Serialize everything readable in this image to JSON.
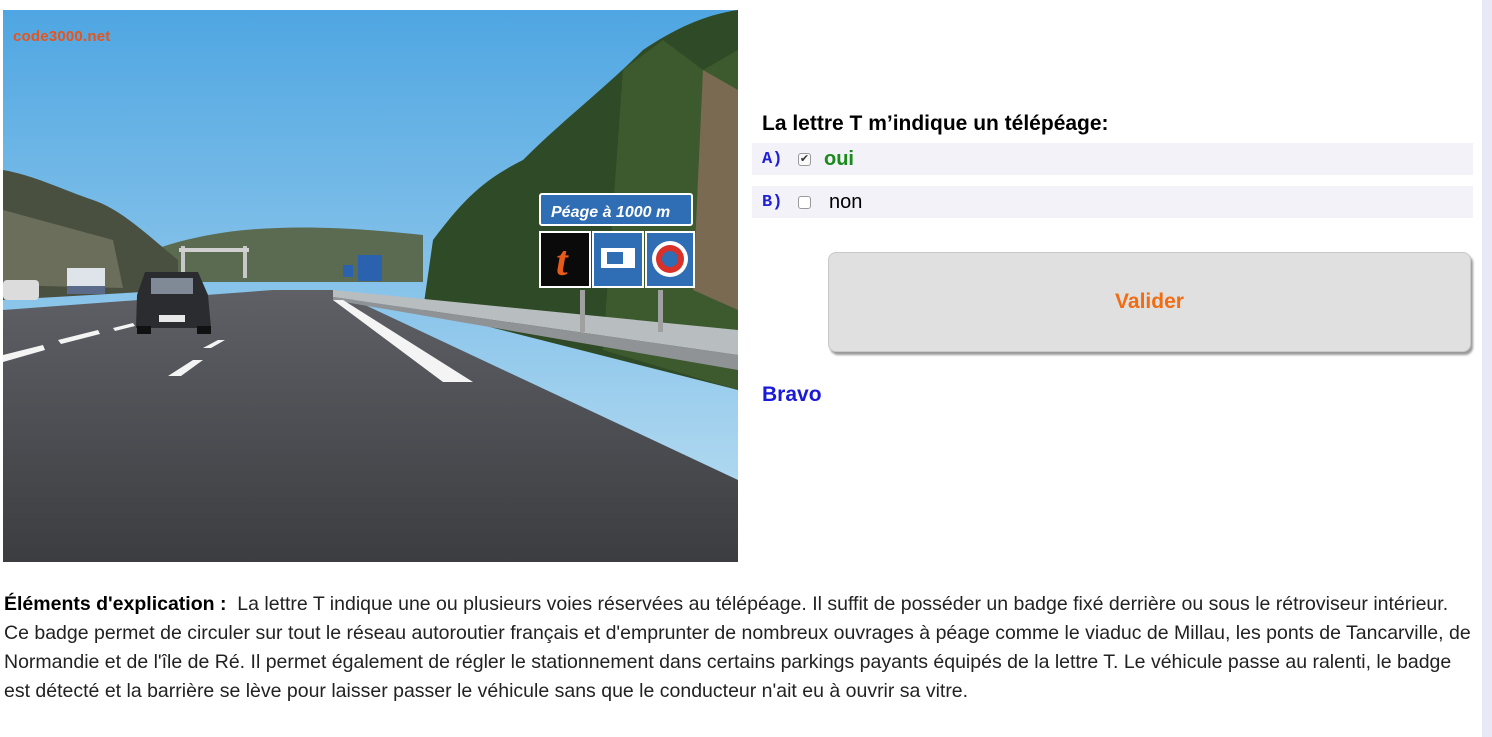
{
  "image": {
    "watermark": "code3000.net",
    "sign_text": "Péage à 1000 m",
    "sign_icons": [
      "telepeage-t-icon",
      "card-payment-icon",
      "stop-circle-icon"
    ]
  },
  "question": {
    "text": "La lettre T m’indique un télépéage:"
  },
  "answers": [
    {
      "letter": "A)",
      "label": "oui",
      "checked": true,
      "correct": true
    },
    {
      "letter": "B)",
      "label": "non",
      "checked": false,
      "correct": false
    }
  ],
  "actions": {
    "validate_label": "Valider"
  },
  "feedback": {
    "text": "Bravo"
  },
  "explanation": {
    "title": "Éléments d'explication :",
    "body": "La lettre T indique une ou plusieurs voies réservées au télépéage. Il suffit de posséder un badge fixé derrière ou sous le rétroviseur intérieur. Ce badge permet de circuler sur tout le réseau autoroutier français et d'emprunter de nombreux ouvrages à péage comme le viaduc de Millau, les ponts de Tancarville, de Normandie et de l'île de Ré. Il permet également de régler le stationnement dans certains parkings payants équipés de la lettre T. Le véhicule passe au ralenti, le badge est détecté et la barrière se lève pour laisser passer le véhicule sans que le conducteur n'ait eu à ouvrir sa vitre."
  },
  "colors": {
    "correct_answer": "#1a8a1a",
    "answer_letter": "#1f1fd6",
    "validate_text": "#f26c12",
    "feedback": "#1a1ad8"
  }
}
